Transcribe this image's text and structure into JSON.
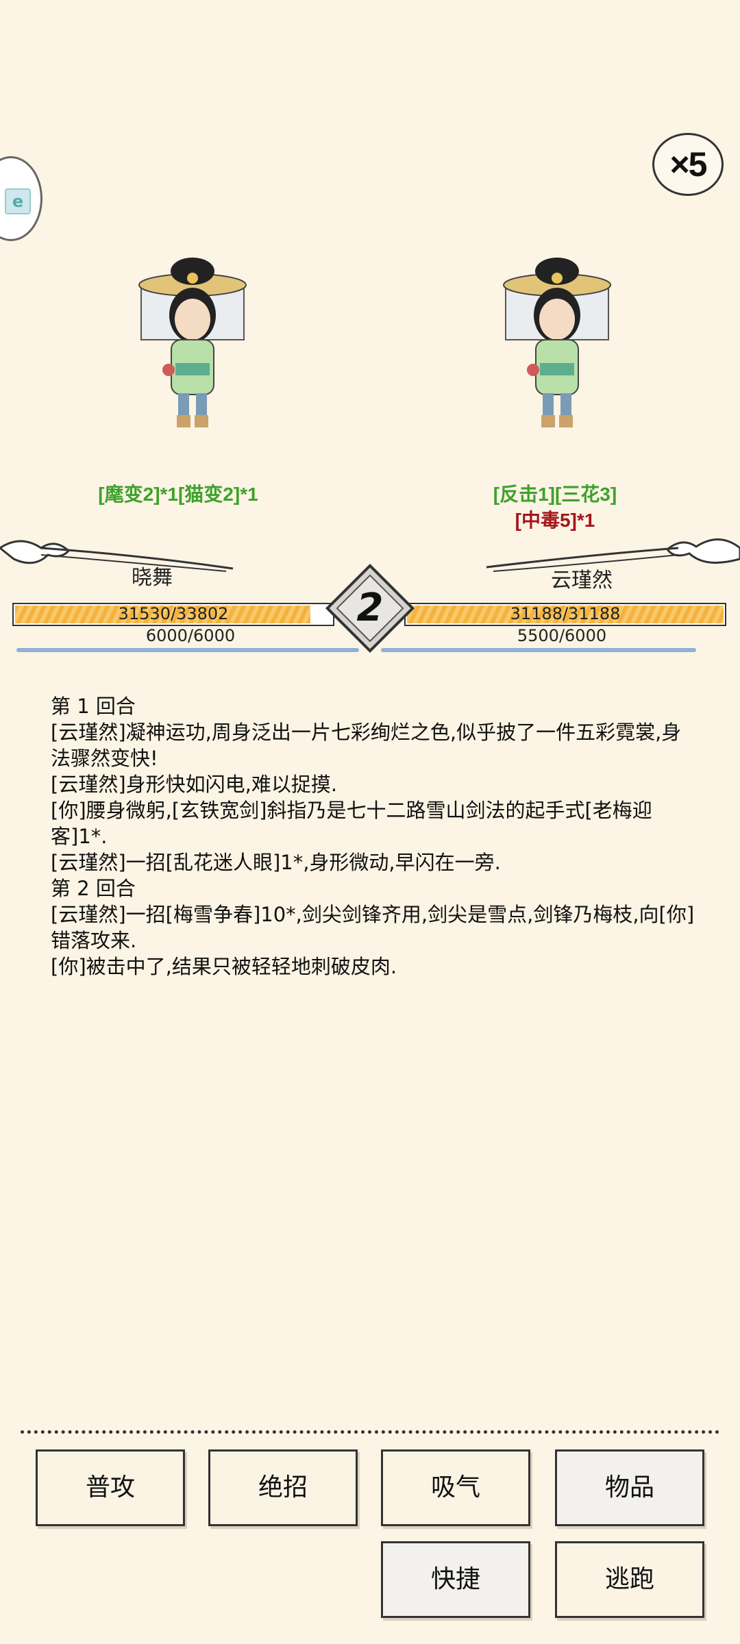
{
  "speed": {
    "label": "×5"
  },
  "left": {
    "name": "晓舞",
    "status": "[麾变2]*1[猫变2]*1",
    "hp": "31530/33802",
    "mp": "6000/6000",
    "hp_ratio": 0.933
  },
  "right": {
    "name": "云瑾然",
    "status1": "[反击1][三花3]",
    "status2": "[中毒5]*1",
    "hp": "31188/31188",
    "mp": "5500/6000",
    "hp_ratio": 1.0
  },
  "round": {
    "number": "2"
  },
  "log": [
    "第 1 回合",
    "[云瑾然]凝神运功,周身泛出一片七彩绚烂之色,似乎披了一件五彩霓裳,身法骤然变快!",
    "[云瑾然]身形快如闪电,难以捉摸.",
    "[你]腰身微躬,[玄铁宽剑]斜指乃是七十二路雪山剑法的起手式[老梅迎客]1*.",
    "[云瑾然]一招[乱花迷人眼]1*,身形微动,早闪在一旁.",
    "第 2 回合",
    "[云瑾然]一招[梅雪争春]10*,剑尖剑锋齐用,剑尖是雪点,剑锋乃梅枝,向[你]错落攻来.",
    "[你]被击中了,结果只被轻轻地刺破皮肉."
  ],
  "actions": {
    "attack": "普攻",
    "ultimate": "绝招",
    "absorb": "吸气",
    "items": "物品",
    "shortcut": "快捷",
    "flee": "逃跑"
  },
  "icons": {
    "speed": "x5-speed-icon",
    "side": "side-menu-icon"
  }
}
